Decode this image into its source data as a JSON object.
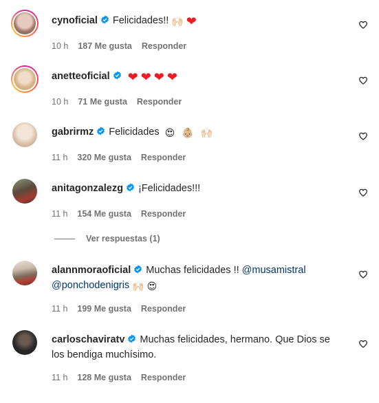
{
  "comments": [
    {
      "username": "cynoficial",
      "text": "Felicidades!!",
      "emojis": [
        "🙌🏻",
        "❤"
      ],
      "time": "10 h",
      "likes": "187 Me gusta",
      "reply": "Responder",
      "story_ring": true,
      "avatar_color": "#c9a99a"
    },
    {
      "username": "anetteoficial",
      "text": "",
      "emojis": [
        "❤",
        "❤",
        "❤",
        "❤"
      ],
      "time": "10 h",
      "likes": "71 Me gusta",
      "reply": "Responder",
      "story_ring": true,
      "avatar_color": "#d9c3a4"
    },
    {
      "username": "gabrirmz",
      "text": "Felicidades",
      "emojis": [
        "😍",
        "👶🏼",
        "🙌🏻"
      ],
      "time": "11 h",
      "likes": "320 Me gusta",
      "reply": "Responder",
      "story_ring": false,
      "avatar_color": "#e8d7c6"
    },
    {
      "username": "anitagonzalezg",
      "text": "¡Felicidades!!!",
      "emojis": [],
      "time": "11 h",
      "likes": "154 Me gusta",
      "reply": "Responder",
      "story_ring": false,
      "avatar_color": "#5a4a3c"
    },
    {
      "username": "alannmoraoficial",
      "text": "Muchas felicidades !!",
      "mention1": "@musamistral",
      "mention2": "@ponchodenigris",
      "emojis": [
        "🙌🏻",
        "😍"
      ],
      "time": "11 h",
      "likes": "199 Me gusta",
      "reply": "Responder",
      "story_ring": false,
      "avatar_color": "#7d6a5a"
    },
    {
      "username": "carloschaviratv",
      "text_line1": "Muchas felicidades, hermano. Que Dios se",
      "text_line2": "los bendiga muchísimo.",
      "emojis": [],
      "time": "11 h",
      "likes": "128 Me gusta",
      "reply": "Responder",
      "story_ring": false,
      "avatar_color": "#2a2a2a"
    }
  ],
  "view_replies": "Ver respuestas (1)",
  "colors": {
    "verified": "#0095f6",
    "heart": "#ed1c24",
    "meta": "#737373",
    "mention": "#00376b"
  },
  "icons": {
    "verified": "verified-badge-icon",
    "like": "heart-outline-icon"
  }
}
